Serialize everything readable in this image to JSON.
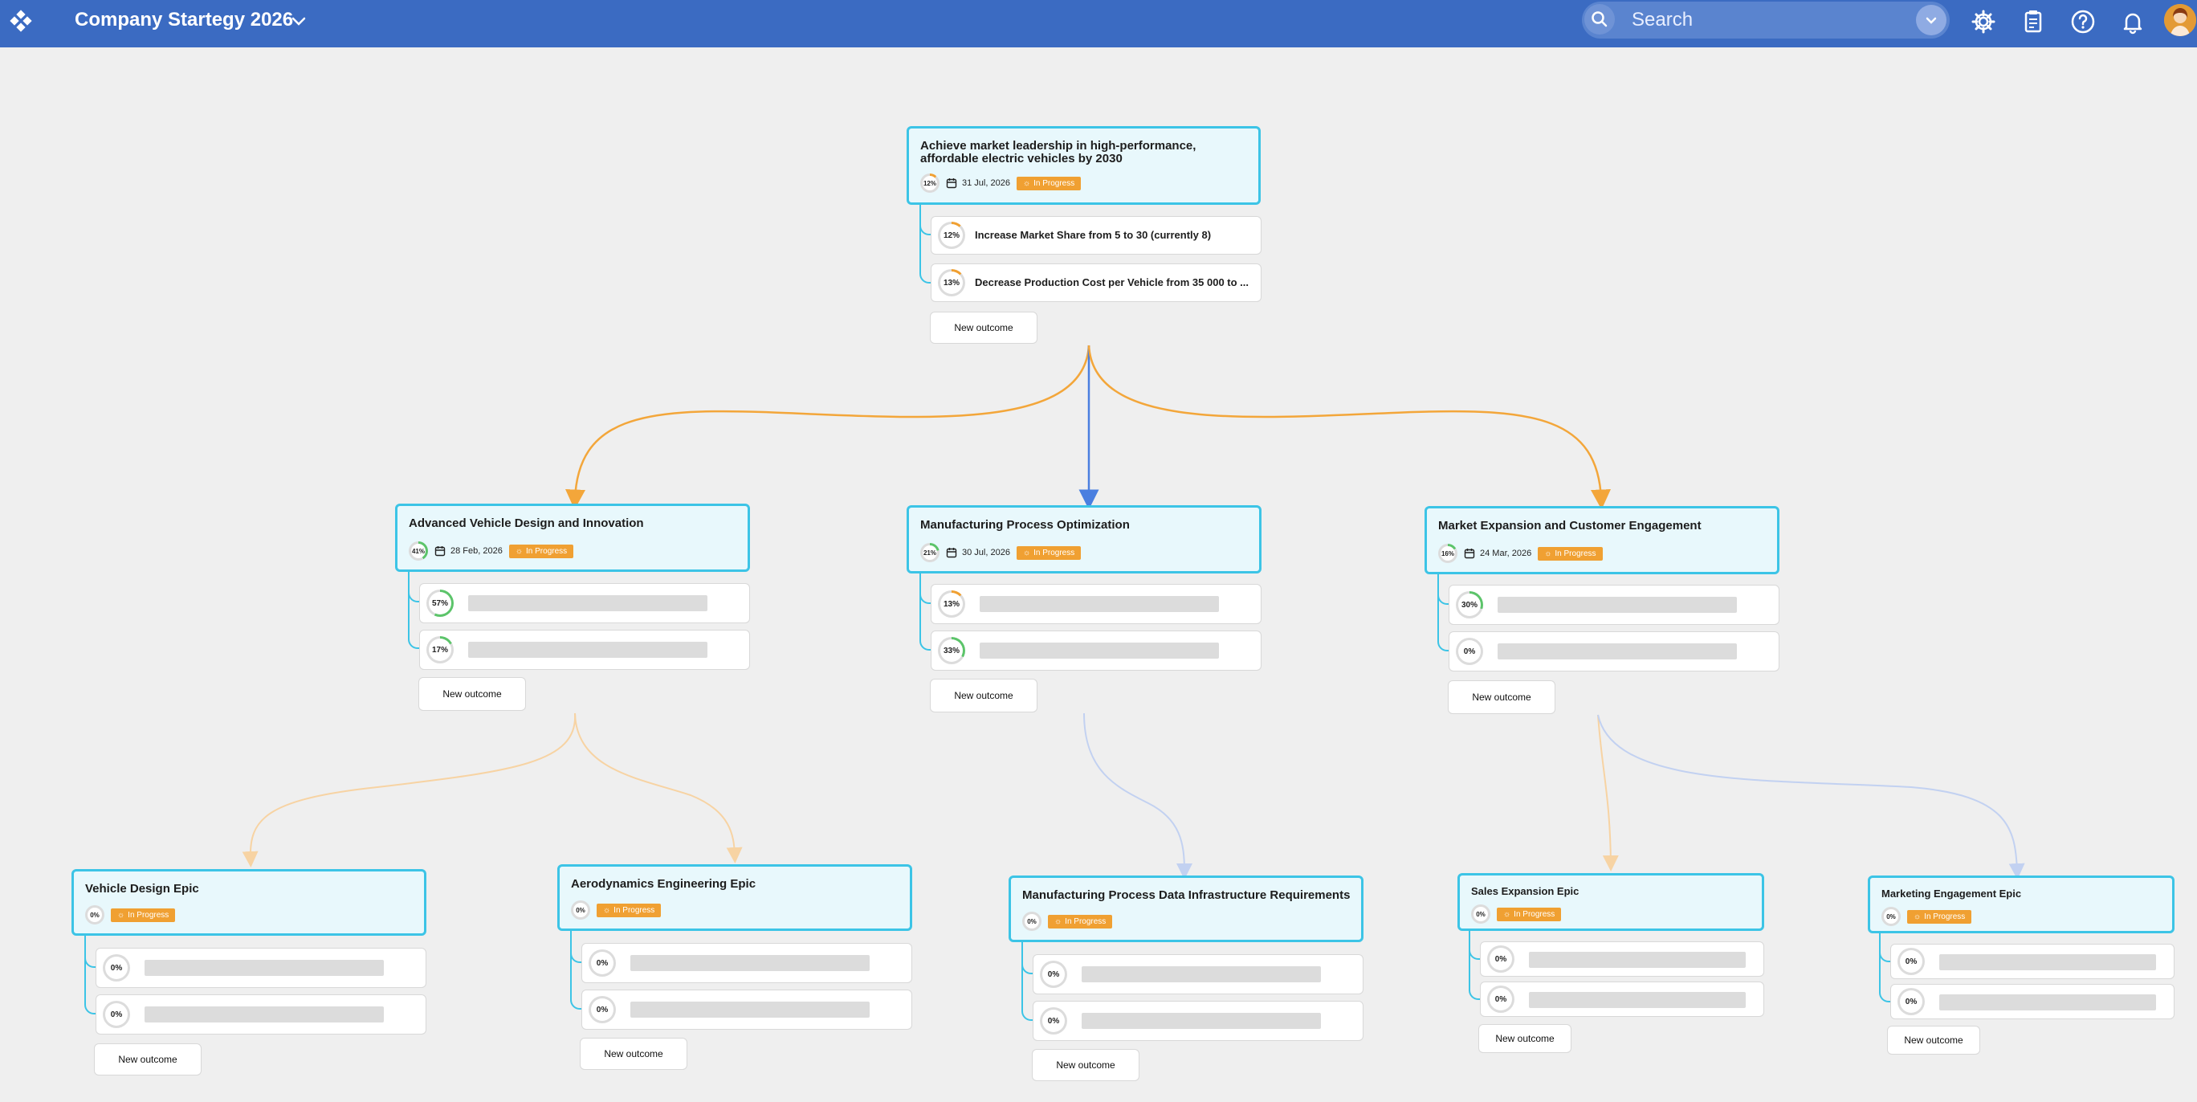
{
  "header": {
    "title": "Company Startegy 2026",
    "search_placeholder": "Search",
    "icons": [
      "settings-icon",
      "clipboard-icon",
      "help-icon",
      "bell-icon"
    ]
  },
  "colors": {
    "accent": "#3cc4e6",
    "status": "#f0a032",
    "topbar": "#3b6bc2",
    "link_orange": "#f3a63a",
    "link_blue": "#4a7fe0"
  },
  "root": {
    "title": "Achieve market leadership in high-performance, affordable electric vehicles by 2030",
    "progress": "12%",
    "date": "31 Jul, 2026",
    "status": "In Progress",
    "outcomes": [
      {
        "progress": "12%",
        "label": "Increase Market Share from 5 to 30 (currently 8)"
      },
      {
        "progress": "13%",
        "label": "Decrease Production Cost per Vehicle from 35 000 to ..."
      }
    ],
    "new_outcome": "New outcome"
  },
  "level2": [
    {
      "title": "Advanced Vehicle Design and Innovation",
      "progress": "41%",
      "date": "28 Feb, 2026",
      "status": "In Progress",
      "outcomes": [
        "57%",
        "17%"
      ],
      "new_outcome": "New outcome"
    },
    {
      "title": "Manufacturing Process Optimization",
      "progress": "21%",
      "date": "30 Jul, 2026",
      "status": "In Progress",
      "outcomes": [
        "13%",
        "33%"
      ],
      "new_outcome": "New outcome"
    },
    {
      "title": "Market Expansion and Customer Engagement",
      "progress": "16%",
      "date": "24 Mar, 2026",
      "status": "In Progress",
      "outcomes": [
        "30%",
        "0%"
      ],
      "new_outcome": "New outcome"
    }
  ],
  "level3": [
    {
      "title": "Vehicle Design Epic",
      "progress": "0%",
      "status": "In Progress",
      "outcomes": [
        "0%",
        "0%"
      ],
      "new_outcome": "New outcome"
    },
    {
      "title": "Aerodynamics Engineering Epic",
      "progress": "0%",
      "status": "In Progress",
      "outcomes": [
        "0%",
        "0%"
      ],
      "new_outcome": "New outcome"
    },
    {
      "title": "Manufacturing Process Data Infrastructure Requirements",
      "progress": "0%",
      "status": "In Progress",
      "outcomes": [
        "0%",
        "0%"
      ],
      "new_outcome": "New outcome"
    },
    {
      "title": "Sales Expansion Epic",
      "progress": "0%",
      "status": "In Progress",
      "outcomes": [
        "0%",
        "0%"
      ],
      "new_outcome": "New outcome"
    },
    {
      "title": "Marketing Engagement Epic",
      "progress": "0%",
      "status": "In Progress",
      "outcomes": [
        "0%",
        "0%"
      ],
      "new_outcome": "New outcome"
    }
  ]
}
